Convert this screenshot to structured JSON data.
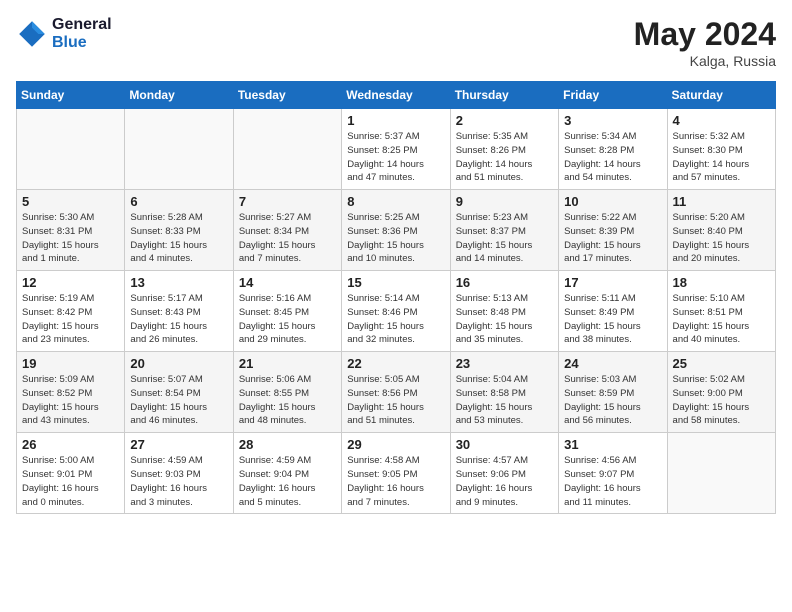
{
  "header": {
    "logo_line1": "General",
    "logo_line2": "Blue",
    "month_year": "May 2024",
    "location": "Kalga, Russia"
  },
  "days_of_week": [
    "Sunday",
    "Monday",
    "Tuesday",
    "Wednesday",
    "Thursday",
    "Friday",
    "Saturday"
  ],
  "weeks": [
    [
      {
        "day": "",
        "info": ""
      },
      {
        "day": "",
        "info": ""
      },
      {
        "day": "",
        "info": ""
      },
      {
        "day": "1",
        "info": "Sunrise: 5:37 AM\nSunset: 8:25 PM\nDaylight: 14 hours\nand 47 minutes."
      },
      {
        "day": "2",
        "info": "Sunrise: 5:35 AM\nSunset: 8:26 PM\nDaylight: 14 hours\nand 51 minutes."
      },
      {
        "day": "3",
        "info": "Sunrise: 5:34 AM\nSunset: 8:28 PM\nDaylight: 14 hours\nand 54 minutes."
      },
      {
        "day": "4",
        "info": "Sunrise: 5:32 AM\nSunset: 8:30 PM\nDaylight: 14 hours\nand 57 minutes."
      }
    ],
    [
      {
        "day": "5",
        "info": "Sunrise: 5:30 AM\nSunset: 8:31 PM\nDaylight: 15 hours\nand 1 minute."
      },
      {
        "day": "6",
        "info": "Sunrise: 5:28 AM\nSunset: 8:33 PM\nDaylight: 15 hours\nand 4 minutes."
      },
      {
        "day": "7",
        "info": "Sunrise: 5:27 AM\nSunset: 8:34 PM\nDaylight: 15 hours\nand 7 minutes."
      },
      {
        "day": "8",
        "info": "Sunrise: 5:25 AM\nSunset: 8:36 PM\nDaylight: 15 hours\nand 10 minutes."
      },
      {
        "day": "9",
        "info": "Sunrise: 5:23 AM\nSunset: 8:37 PM\nDaylight: 15 hours\nand 14 minutes."
      },
      {
        "day": "10",
        "info": "Sunrise: 5:22 AM\nSunset: 8:39 PM\nDaylight: 15 hours\nand 17 minutes."
      },
      {
        "day": "11",
        "info": "Sunrise: 5:20 AM\nSunset: 8:40 PM\nDaylight: 15 hours\nand 20 minutes."
      }
    ],
    [
      {
        "day": "12",
        "info": "Sunrise: 5:19 AM\nSunset: 8:42 PM\nDaylight: 15 hours\nand 23 minutes."
      },
      {
        "day": "13",
        "info": "Sunrise: 5:17 AM\nSunset: 8:43 PM\nDaylight: 15 hours\nand 26 minutes."
      },
      {
        "day": "14",
        "info": "Sunrise: 5:16 AM\nSunset: 8:45 PM\nDaylight: 15 hours\nand 29 minutes."
      },
      {
        "day": "15",
        "info": "Sunrise: 5:14 AM\nSunset: 8:46 PM\nDaylight: 15 hours\nand 32 minutes."
      },
      {
        "day": "16",
        "info": "Sunrise: 5:13 AM\nSunset: 8:48 PM\nDaylight: 15 hours\nand 35 minutes."
      },
      {
        "day": "17",
        "info": "Sunrise: 5:11 AM\nSunset: 8:49 PM\nDaylight: 15 hours\nand 38 minutes."
      },
      {
        "day": "18",
        "info": "Sunrise: 5:10 AM\nSunset: 8:51 PM\nDaylight: 15 hours\nand 40 minutes."
      }
    ],
    [
      {
        "day": "19",
        "info": "Sunrise: 5:09 AM\nSunset: 8:52 PM\nDaylight: 15 hours\nand 43 minutes."
      },
      {
        "day": "20",
        "info": "Sunrise: 5:07 AM\nSunset: 8:54 PM\nDaylight: 15 hours\nand 46 minutes."
      },
      {
        "day": "21",
        "info": "Sunrise: 5:06 AM\nSunset: 8:55 PM\nDaylight: 15 hours\nand 48 minutes."
      },
      {
        "day": "22",
        "info": "Sunrise: 5:05 AM\nSunset: 8:56 PM\nDaylight: 15 hours\nand 51 minutes."
      },
      {
        "day": "23",
        "info": "Sunrise: 5:04 AM\nSunset: 8:58 PM\nDaylight: 15 hours\nand 53 minutes."
      },
      {
        "day": "24",
        "info": "Sunrise: 5:03 AM\nSunset: 8:59 PM\nDaylight: 15 hours\nand 56 minutes."
      },
      {
        "day": "25",
        "info": "Sunrise: 5:02 AM\nSunset: 9:00 PM\nDaylight: 15 hours\nand 58 minutes."
      }
    ],
    [
      {
        "day": "26",
        "info": "Sunrise: 5:00 AM\nSunset: 9:01 PM\nDaylight: 16 hours\nand 0 minutes."
      },
      {
        "day": "27",
        "info": "Sunrise: 4:59 AM\nSunset: 9:03 PM\nDaylight: 16 hours\nand 3 minutes."
      },
      {
        "day": "28",
        "info": "Sunrise: 4:59 AM\nSunset: 9:04 PM\nDaylight: 16 hours\nand 5 minutes."
      },
      {
        "day": "29",
        "info": "Sunrise: 4:58 AM\nSunset: 9:05 PM\nDaylight: 16 hours\nand 7 minutes."
      },
      {
        "day": "30",
        "info": "Sunrise: 4:57 AM\nSunset: 9:06 PM\nDaylight: 16 hours\nand 9 minutes."
      },
      {
        "day": "31",
        "info": "Sunrise: 4:56 AM\nSunset: 9:07 PM\nDaylight: 16 hours\nand 11 minutes."
      },
      {
        "day": "",
        "info": ""
      }
    ]
  ]
}
